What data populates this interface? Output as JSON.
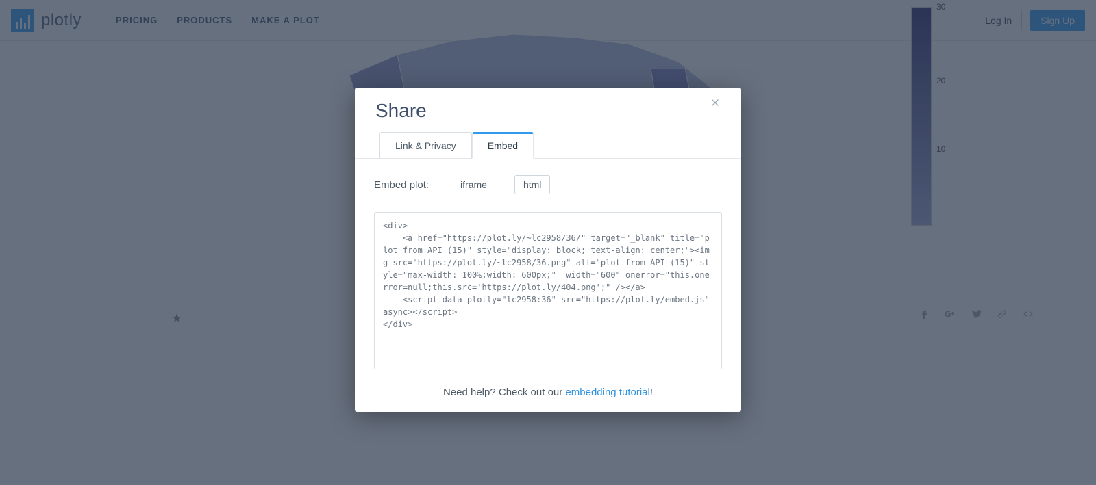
{
  "nav": {
    "brand": "plotly",
    "links": [
      "PRICING",
      "PRODUCTS",
      "MAKE A PLOT"
    ],
    "login": "Log In",
    "signup": "Sign Up"
  },
  "colorbar": {
    "ticks": [
      "30",
      "20",
      "10"
    ]
  },
  "social_icons": [
    "facebook",
    "google-plus",
    "twitter",
    "link",
    "code"
  ],
  "modal": {
    "title": "Share",
    "tabs": {
      "link_privacy": "Link & Privacy",
      "embed": "Embed"
    },
    "embed_label": "Embed plot:",
    "format_options": {
      "iframe": "iframe",
      "html": "html"
    },
    "selected_format": "html",
    "code": "<div>\n    <a href=\"https://plot.ly/~lc2958/36/\" target=\"_blank\" title=\"plot from API (15)\" style=\"display: block; text-align: center;\"><img src=\"https://plot.ly/~lc2958/36.png\" alt=\"plot from API (15)\" style=\"max-width: 100%;width: 600px;\"  width=\"600\" onerror=\"this.onerror=null;this.src='https://plot.ly/404.png';\" /></a>\n    <script data-plotly=\"lc2958:36\" src=\"https://plot.ly/embed.js\" async></script>\n</div>",
    "help_prefix": "Need help? Check out our ",
    "help_link": "embedding tutorial",
    "help_suffix": "!"
  }
}
